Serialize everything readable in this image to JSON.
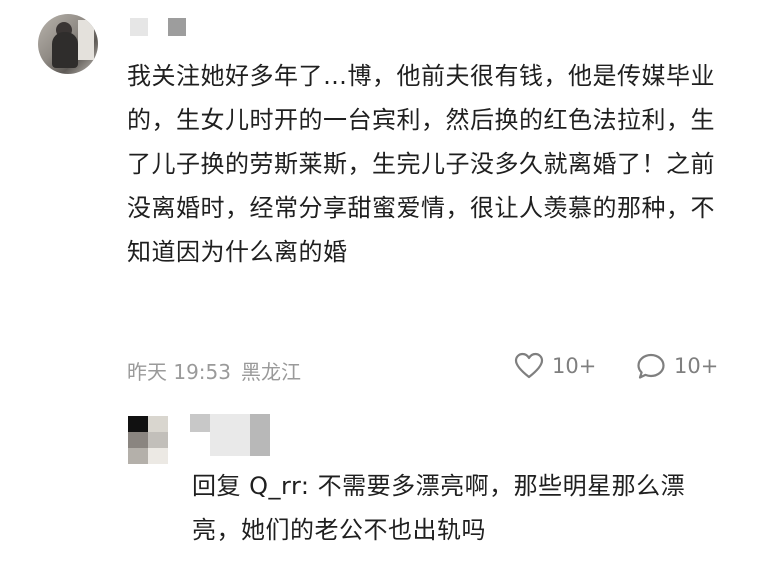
{
  "comment": {
    "text": "我关注她好多年了…博，他前夫很有钱，他是传媒毕业的，生女儿时开的一台宾利，然后换的红色法拉利，生了儿子换的劳斯莱斯，生完儿子没多久就离婚了！之前没离婚时，经常分享甜蜜爱情，很让人羡慕的那种，不知道因为什么离的婚",
    "time": "昨天 19:53",
    "location": "黑龙江",
    "likes": "10+",
    "replies_count": "10+",
    "icons": {
      "like": "heart-icon",
      "reply": "speech-bubble-icon"
    }
  },
  "reply": {
    "prefix": "回复",
    "target": "Q_rr:",
    "text": "不需要多漂亮啊，那些明星那么漂亮，她们的老公不也出轨吗"
  },
  "colors": {
    "meta_gray": "#9a9a9a",
    "text": "#1f1f1f",
    "icon_gray": "#7f7f7f"
  }
}
